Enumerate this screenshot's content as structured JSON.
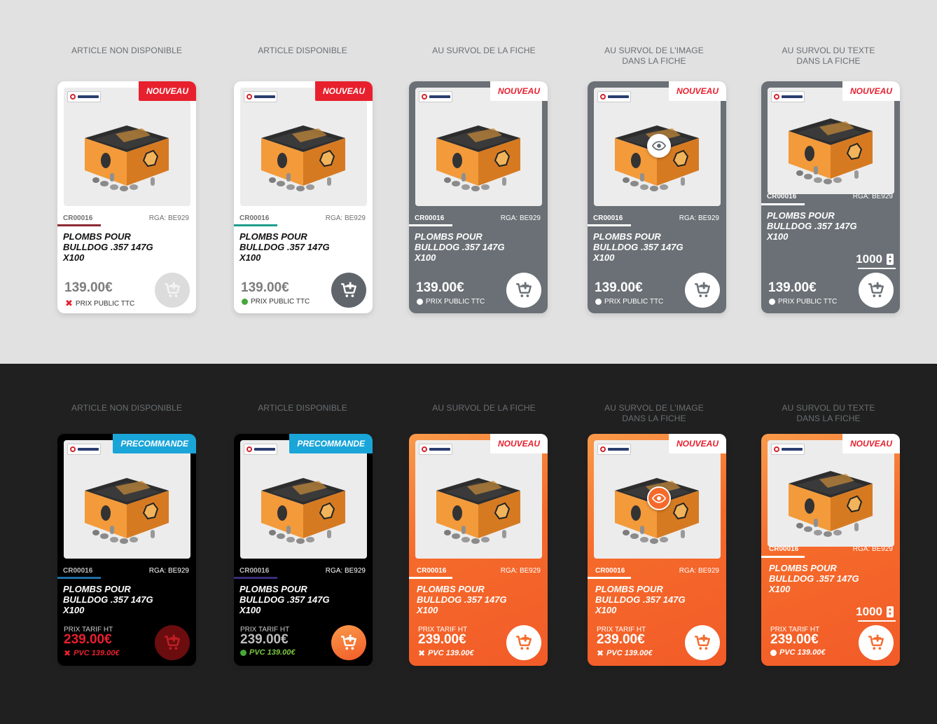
{
  "captions": {
    "not_available": "ARTICLE NON DISPONIBLE",
    "available": "ARTICLE DISPONIBLE",
    "hover_card": "AU SURVOL DE LA FICHE",
    "hover_image_l1": "AU SURVOL DE L'IMAGE",
    "hover_image_l2": "DANS LA FICHE",
    "hover_text_l1": "AU SURVOL DU TEXTE",
    "hover_text_l2": "DANS LA FICHE"
  },
  "product": {
    "ref": "CR00016",
    "rga": "RGA: BE929",
    "title_l1": "PLOMBS POUR",
    "title_l2": "BULLDOG .357 147G",
    "title_l3": "X100",
    "price_public": "139.00€",
    "price_public_label": "PRIX PUBLIC TTC",
    "tarif_label": "PRIX TARIF HT",
    "price_tarif": "239.00€",
    "pvc": "PVC 139.00€",
    "quantity": "1000"
  },
  "badges": {
    "new": "NOUVEAU",
    "preorder": "PRECOMMANDE"
  },
  "colors": {
    "red": "#e8202e",
    "blue": "#1aa5d8",
    "green": "#2e9b2e",
    "grey_card": "#6a7075",
    "orange": "#f56a2b"
  },
  "icons": {
    "cart": "cart-plus-icon",
    "eye": "eye-icon",
    "unavailable": "cross-icon",
    "available": "dot-icon"
  }
}
